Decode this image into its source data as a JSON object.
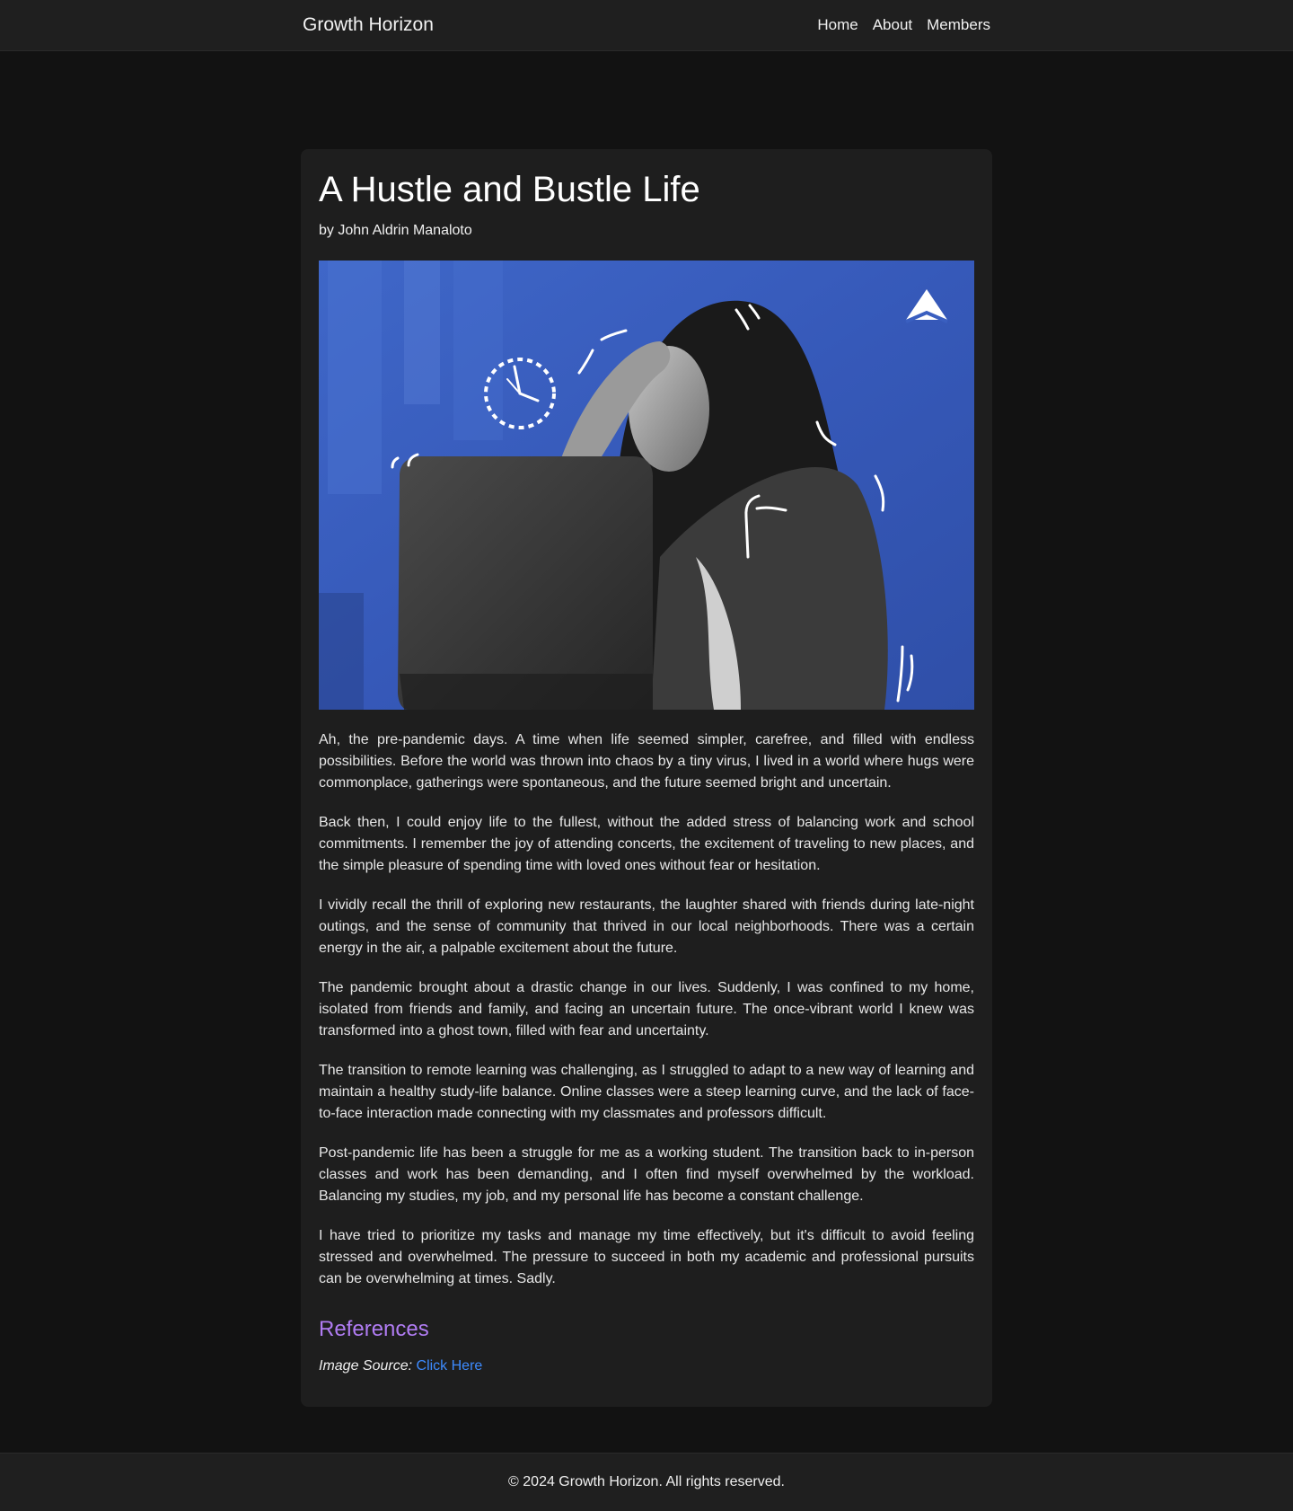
{
  "header": {
    "brand": "Growth Horizon",
    "nav": [
      {
        "label": "Home"
      },
      {
        "label": "About"
      },
      {
        "label": "Members"
      }
    ]
  },
  "article": {
    "title": "A Hustle and Bustle Life",
    "byline": "by John Aldrin Manaloto",
    "paragraphs": [
      "Ah, the pre-pandemic days. A time when life seemed simpler, carefree, and filled with endless possibilities. Before the world was thrown into chaos by a tiny virus, I lived in a world where hugs were commonplace, gatherings were spontaneous, and the future seemed bright and uncertain.",
      "Back then, I could enjoy life to the fullest, without the added stress of balancing work and school commitments. I remember the joy of attending concerts, the excitement of traveling to new places, and the simple pleasure of spending time with loved ones without fear or hesitation.",
      "I vividly recall the thrill of exploring new restaurants, the laughter shared with friends during late-night outings, and the sense of community that thrived in our local neighborhoods. There was a certain energy in the air, a palpable excitement about the future.",
      "The pandemic brought about a drastic change in our lives. Suddenly, I was confined to my home, isolated from friends and family, and facing an uncertain future. The once-vibrant world I knew was transformed into a ghost town, filled with fear and uncertainty.",
      "The transition to remote learning was challenging, as I struggled to adapt to a new way of learning and maintain a healthy study-life balance. Online classes were a steep learning curve, and the lack of face-to-face interaction made connecting with my classmates and professors difficult.",
      "Post-pandemic life has been a struggle for me as a working student. The transition back to in-person classes and work has been demanding, and I often find myself overwhelmed by the workload. Balancing my studies, my job, and my personal life has become a constant challenge.",
      "I have tried to prioritize my tasks and manage my time effectively, but it's difficult to avoid feeling stressed and overwhelmed. The pressure to succeed in both my academic and professional pursuits can be overwhelming at times. Sadly."
    ],
    "references": {
      "heading": "References",
      "source_label": "Image Source:",
      "link_text": "Click Here"
    }
  },
  "footer": {
    "text": "© 2024 Growth Horizon. All rights reserved."
  },
  "colors": {
    "page_bg": "#121212",
    "card_bg": "#1e1e1e",
    "bar_bg": "#1f1f1f",
    "references_heading": "#b07cf2",
    "link": "#3d8bff",
    "hero_blue": "#3a5fc0"
  }
}
